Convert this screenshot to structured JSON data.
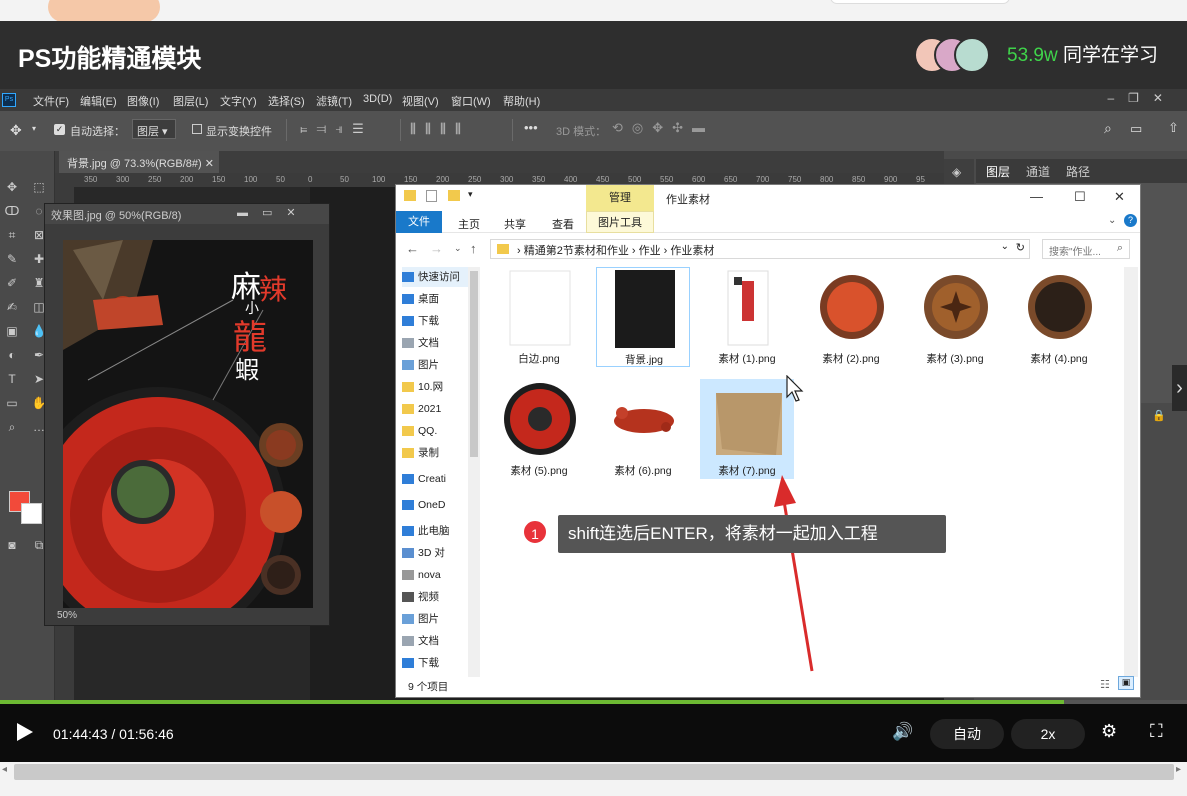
{
  "course": {
    "title": "PS功能精通模块",
    "learners_count": "53.9w",
    "learners_label": " 同学在学习"
  },
  "photoshop": {
    "menu": [
      "文件(F)",
      "编辑(E)",
      "图像(I)",
      "图层(L)",
      "文字(Y)",
      "选择(S)",
      "滤镜(T)",
      "3D(D)",
      "视图(V)",
      "窗口(W)",
      "帮助(H)"
    ],
    "options": {
      "auto_select_label": "自动选择：",
      "auto_select_value": "图层",
      "show_transform_label": "显示变换控件",
      "mode_3d_label": "3D 模式："
    },
    "doc_tab": "背景.jpg @ 73.3%(RGB/8#)",
    "effect_window_title": "效果图.jpg @ 50%(RGB/8)",
    "effect_zoom": "50%",
    "ruler_ticks": [
      "350",
      "300",
      "250",
      "200",
      "150",
      "100",
      "50",
      "0",
      "50",
      "100",
      "150",
      "200",
      "250",
      "300",
      "350",
      "400",
      "450",
      "500",
      "550",
      "600",
      "650",
      "700",
      "750",
      "800",
      "850",
      "900",
      "95"
    ],
    "right_tabs": [
      "图层",
      "通道",
      "路径"
    ],
    "foreground_color": "#f24a3a",
    "background_color": "#ffffff"
  },
  "explorer": {
    "ribbon_context_tab": "管理",
    "window_title": "作业素材",
    "ribbon_tabs": [
      "文件",
      "主页",
      "共享",
      "查看"
    ],
    "picture_tools": "图片工具",
    "address_path": "精通第2节素材和作业 › 作业 › 作业素材",
    "search_placeholder": "搜索\"作业...",
    "nav_items": [
      {
        "label": "快速访问",
        "icon": "star"
      },
      {
        "label": "桌面",
        "icon": "desktop"
      },
      {
        "label": "下载",
        "icon": "download"
      },
      {
        "label": "文档",
        "icon": "document"
      },
      {
        "label": "图片",
        "icon": "picture"
      },
      {
        "label": "10.网",
        "icon": "folder"
      },
      {
        "label": "2021",
        "icon": "folder"
      },
      {
        "label": "QQ.",
        "icon": "folder"
      },
      {
        "label": "录制",
        "icon": "folder"
      },
      {
        "label": "Creati",
        "icon": "cloud"
      },
      {
        "label": "OneD",
        "icon": "cloud"
      },
      {
        "label": "此电脑",
        "icon": "computer"
      },
      {
        "label": "3D 对",
        "icon": "cube"
      },
      {
        "label": "nova",
        "icon": "device"
      },
      {
        "label": "视频",
        "icon": "video"
      },
      {
        "label": "图片",
        "icon": "picture"
      },
      {
        "label": "文档",
        "icon": "document"
      },
      {
        "label": "下载",
        "icon": "download"
      }
    ],
    "files": [
      {
        "name": "白边.png",
        "thumb": "white",
        "selected": false
      },
      {
        "name": "背景.jpg",
        "thumb": "dark",
        "selected": true
      },
      {
        "name": "素材 (1).png",
        "thumb": "poster",
        "selected": false
      },
      {
        "name": "素材 (2).png",
        "thumb": "chili",
        "selected": false
      },
      {
        "name": "素材 (3).png",
        "thumb": "anise",
        "selected": false
      },
      {
        "name": "素材 (4).png",
        "thumb": "pepper",
        "selected": false
      },
      {
        "name": "素材 (5).png",
        "thumb": "plate",
        "selected": false
      },
      {
        "name": "素材 (6).png",
        "thumb": "crayfish",
        "selected": false
      },
      {
        "name": "素材 (7).png",
        "thumb": "burlap",
        "selected": true
      }
    ],
    "status": "9 个项目"
  },
  "annotation": {
    "badge": "1",
    "text": "shift连选后ENTER，将素材一起加入工程"
  },
  "player": {
    "current_time": "01:44:43",
    "separator": " / ",
    "duration": "01:56:46",
    "progress": 0.8965,
    "auto_label": "自动",
    "rate_label": "2x"
  }
}
